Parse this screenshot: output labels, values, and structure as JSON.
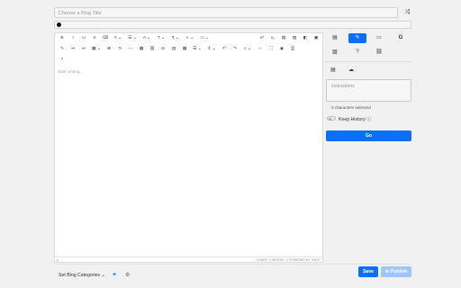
{
  "header": {
    "title_placeholder": "Choose a Blog Title",
    "shuffle_icon": "shuffle-icon"
  },
  "editor": {
    "placeholder": "Start writing...",
    "toolbar_row1": [
      "B",
      "I",
      "U",
      "S",
      "⌫",
      "≡ ⌄",
      "☰ ⌄",
      "A ⌄",
      "T ⌄",
      "¶ ⌄",
      "◐ ⌄",
      "▭ ⌄",
      "x²",
      "x₂",
      "▤",
      "▨",
      "◧",
      "▣"
    ],
    "toolbar_row2": [
      "✎",
      "↤",
      "↦",
      "▦ ⌄",
      "⊞",
      "T̷",
      "―",
      "▦",
      "⛓",
      "Ω",
      "▥",
      "▦",
      "☰ ⌄",
      "⇕ ⌄",
      "↶",
      "↷",
      "⌕ ⌄",
      "‹›",
      "⛶",
      "◉",
      "⎙"
    ],
    "toolbar_row3": [
      "?"
    ],
    "footer_left": "p",
    "footer_right": "CHARS: 0   WORDS: 0   POWERED BY JODIT"
  },
  "sidebar": {
    "tabs_row1": [
      "▤",
      "✎",
      "▭",
      "G"
    ],
    "tabs_row2": [
      "▨",
      "?",
      "⛓"
    ],
    "subtabs": [
      "▤",
      "☁"
    ],
    "instructions_placeholder": "Instructions",
    "chars_selected": "0 characters selected",
    "keep_history_label": "Keep History",
    "info_icon": "ⓘ",
    "go_label": "Go"
  },
  "footer": {
    "categories_label": "Set Blog Categories ⌄",
    "plus": "+",
    "gear": "⚙",
    "save_label": "Save",
    "publish_label": "⊕ Publish"
  },
  "colors": {
    "accent": "#0d6efd",
    "accent_disabled": "#9ec5fe"
  }
}
